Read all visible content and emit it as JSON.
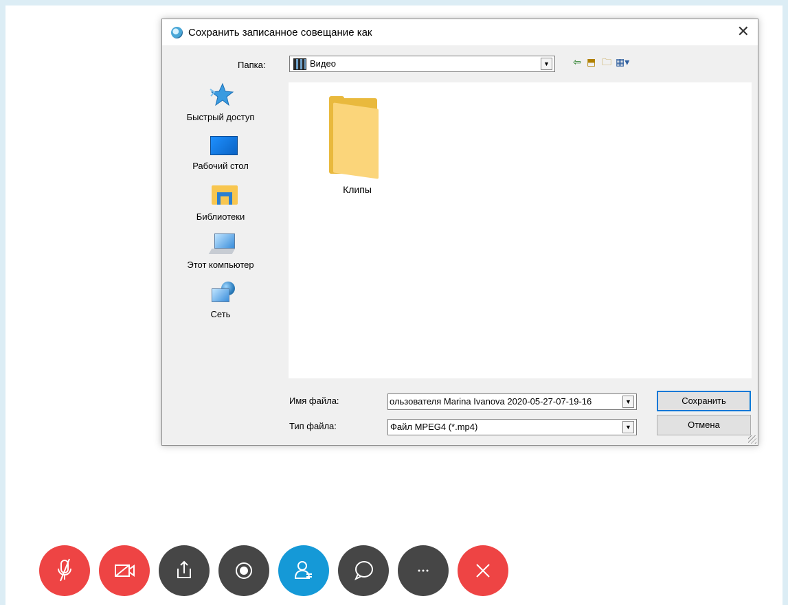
{
  "dialog": {
    "title": "Сохранить записанное совещание как",
    "folder_label": "Папка:",
    "folder_value": "Видео",
    "places": [
      {
        "label": "Быстрый доступ",
        "icon": "quick-access-star-icon"
      },
      {
        "label": "Рабочий стол",
        "icon": "desktop-icon"
      },
      {
        "label": "Библиотеки",
        "icon": "libraries-icon"
      },
      {
        "label": "Этот компьютер",
        "icon": "this-pc-icon"
      },
      {
        "label": "Сеть",
        "icon": "network-icon"
      }
    ],
    "files": [
      {
        "name": "Клипы",
        "icon": "folder-icon"
      }
    ],
    "filename_label": "Имя файла:",
    "filename_value": "ользователя Marina Ivanova 2020-05-27-07-19-16",
    "filetype_label": "Тип файла:",
    "filetype_value": "Файл MPEG4 (*.mp4)",
    "save_label": "Сохранить",
    "cancel_label": "Отмена"
  },
  "callbar": {
    "buttons": [
      {
        "name": "mute-microphone",
        "color": "#ee4444"
      },
      {
        "name": "stop-video",
        "color": "#ee4444"
      },
      {
        "name": "share-content",
        "color": "#464646"
      },
      {
        "name": "record",
        "color": "#464646"
      },
      {
        "name": "participants",
        "color": "#1599d7"
      },
      {
        "name": "chat",
        "color": "#464646"
      },
      {
        "name": "more-options",
        "color": "#464646"
      },
      {
        "name": "leave-meeting",
        "color": "#ee4444"
      }
    ]
  }
}
